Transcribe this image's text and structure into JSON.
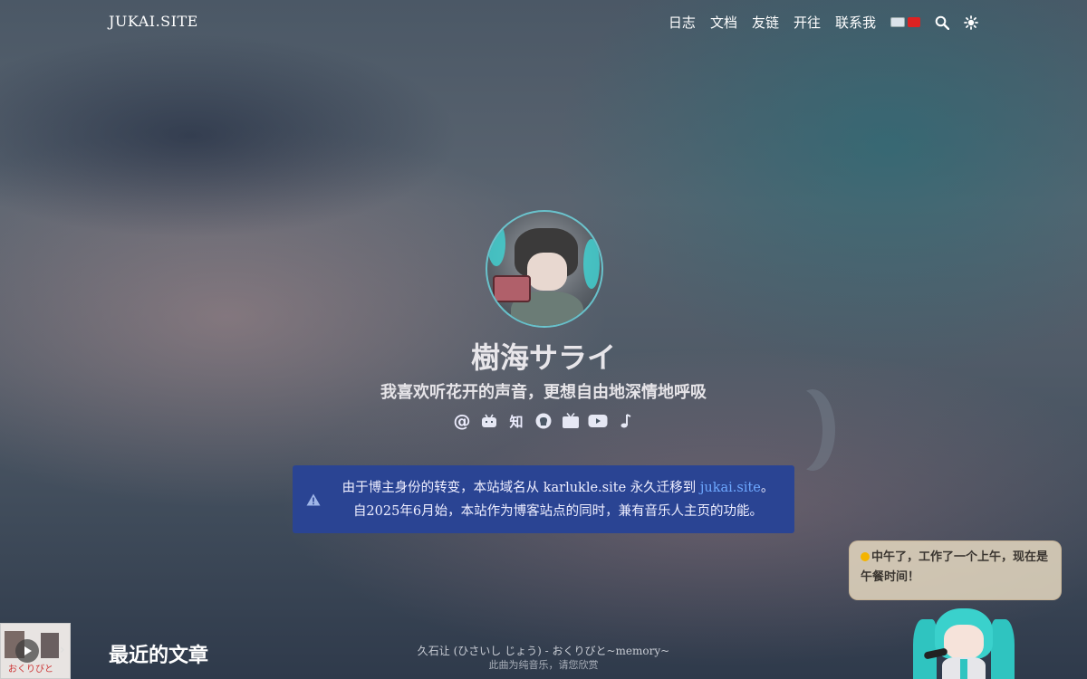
{
  "nav": {
    "brand": "JUKAI.SITE",
    "links": [
      "日志",
      "文档",
      "友链",
      "开往",
      "联系我"
    ],
    "icons": [
      "language-switch-icon",
      "search-icon",
      "theme-toggle-icon"
    ]
  },
  "hero": {
    "title": "樹海サライ",
    "subtitle": "我喜欢听花开的声音，更想自由地深情地呼吸",
    "socials": [
      "email-icon",
      "bilibili-icon",
      "zhihu-icon",
      "github-icon",
      "tv-icon",
      "youtube-icon",
      "music-icon"
    ],
    "zhihu_label": "知",
    "email_label": "@"
  },
  "notice": {
    "line1_prefix": "由于博主身份的转变，本站域名从 karlukle.site 永久迁移到 ",
    "line1_link": "jukai.site",
    "line1_suffix": "。",
    "line2": "自2025年6月始，本站作为博客站点的同时，兼有音乐人主页的功能。"
  },
  "mascot": {
    "message": "中午了，工作了一个上午，现在是午餐时间！"
  },
  "section": {
    "recent_posts": "最近的文章"
  },
  "player": {
    "song_title": "久石让 (ひさいし じょう) - おくりびと~memory~",
    "song_note": "此曲为纯音乐，请您欣赏",
    "cover_text": "おくりびと"
  },
  "colors": {
    "notice_bg": "#2a4493",
    "link": "#6ea8ff",
    "bubble_bg": "#ecdec4"
  }
}
